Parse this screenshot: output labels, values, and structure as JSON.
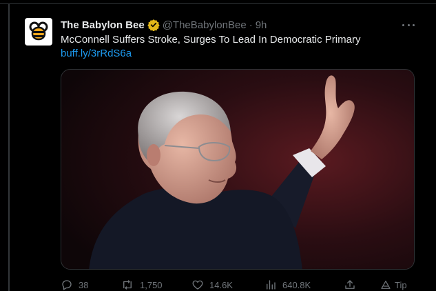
{
  "tweet": {
    "author_name": "The Babylon Bee",
    "handle": "@TheBabylonBee",
    "separator": "·",
    "time": "9h",
    "text": "McConnell Suffers Stroke, Surges To Lead In Democratic Primary",
    "link": "buff.ly/3rRdS6a"
  },
  "actions": {
    "replies": "38",
    "reposts": "1,750",
    "likes": "14.6K",
    "views": "640.8K",
    "tip_label": "Tip"
  },
  "icons": {
    "avatar": "babylon-bee-logo",
    "verified": "gold-verified-badge",
    "more": "more-icon",
    "reply": "reply-icon",
    "repost": "repost-icon",
    "like": "heart-icon",
    "views": "views-icon",
    "share": "share-icon",
    "tip": "tip-icon"
  },
  "colors": {
    "background": "#000000",
    "text": "#e7e9ea",
    "muted": "#71767b",
    "link": "#1d9bf0",
    "verified_gold": "#e2b719"
  }
}
